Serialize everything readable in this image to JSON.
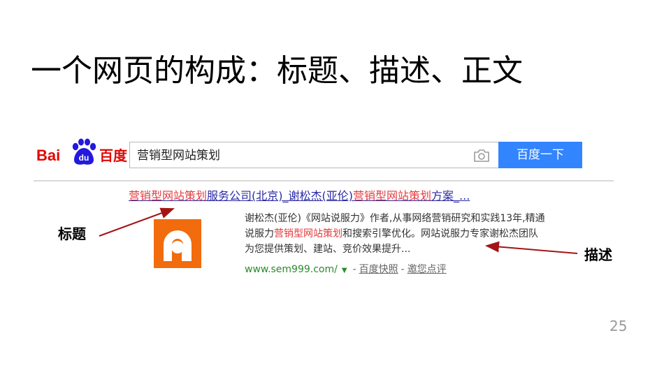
{
  "slide": {
    "title": "一个网页的构成：标题、描述、正文",
    "page_number": "25"
  },
  "logo": {
    "bai": "Bai",
    "du": "du",
    "cn": "百度"
  },
  "search": {
    "query": "营销型网站策划",
    "button_label": "百度一下"
  },
  "result": {
    "title_parts": {
      "p1": "营销型网站策划",
      "p2": "服务公司(北京)_谢松杰(亚伦)",
      "p3": "营销型网站策划",
      "p4": "方案_..."
    },
    "description": {
      "line1": "谢松杰(亚伦)《网站说服力》作者,从事网络营销研究和实践13年,精通",
      "line2_pre": "说服力",
      "line2_hl": "营销型网站策划",
      "line2_post": "和搜索引擎优化。网站说服力专家谢松杰团队",
      "line3": "为您提供策划、建站、竞价效果提升..."
    },
    "url": "www.sem999.com/",
    "snapshot_label": "百度快照",
    "rate_label": "邀您点评",
    "separator": "-"
  },
  "annotations": {
    "title_label": "标题",
    "description_label": "描述",
    "arrow_color": "#a31515"
  },
  "colors": {
    "baidu_red": "#e10602",
    "baidu_blue": "#2319dc",
    "button_blue": "#3385ff",
    "highlight_red": "#e4393c",
    "link_blue": "#2a2aa6",
    "url_green": "#2c8a2c",
    "thumb_orange": "#f26b0c"
  }
}
